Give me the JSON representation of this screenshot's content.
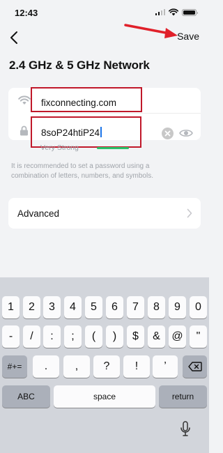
{
  "status_bar": {
    "time": "12:43"
  },
  "header": {
    "save_label": "Save"
  },
  "page": {
    "title": "2.4 GHz & 5 GHz Network"
  },
  "network": {
    "ssid": "fixconnecting.com",
    "password": "8soP24htiP24",
    "strength_label": "Very Strong",
    "strength_color": "#2ac26a"
  },
  "hint": "It is recommended to set a password using a combination of letters, numbers, and symbols.",
  "advanced": {
    "label": "Advanced"
  },
  "keyboard": {
    "row1": [
      "1",
      "2",
      "3",
      "4",
      "5",
      "6",
      "7",
      "8",
      "9",
      "0"
    ],
    "row2": [
      "-",
      "/",
      ":",
      ";",
      "(",
      ")",
      "$",
      "&",
      "@",
      "\""
    ],
    "row3": [
      ".",
      ",",
      "?",
      "!",
      "’"
    ],
    "shift_label": "#+=",
    "abc_label": "ABC",
    "space_label": "space",
    "return_label": "return"
  },
  "colors": {
    "annotation": "#e0202a",
    "accent": "#1a73e8"
  }
}
